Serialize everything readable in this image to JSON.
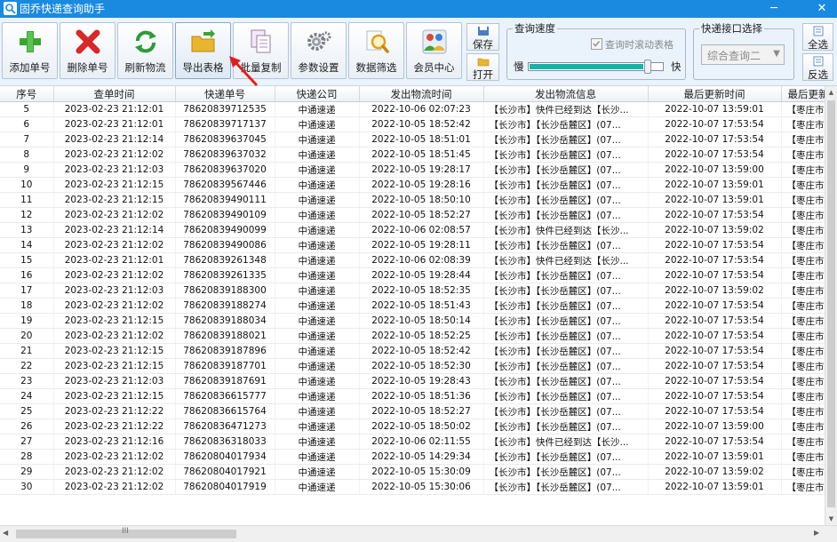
{
  "window": {
    "title": "固乔快递查询助手",
    "minimize": "─",
    "close": "✕"
  },
  "toolbar": {
    "buttons": [
      {
        "label": "添加单号",
        "icon": "add-plus-icon"
      },
      {
        "label": "删除单号",
        "icon": "delete-x-icon"
      },
      {
        "label": "刷新物流",
        "icon": "refresh-icon"
      },
      {
        "label": "导出表格",
        "icon": "export-folder-icon"
      },
      {
        "label": "批量复制",
        "icon": "copy-documents-icon"
      },
      {
        "label": "参数设置",
        "icon": "settings-gear-icon"
      },
      {
        "label": "数据筛选",
        "icon": "filter-magnifier-icon"
      },
      {
        "label": "会员中心",
        "icon": "member-users-icon"
      }
    ],
    "save_label": "保存",
    "open_label": "打开",
    "speed_group": {
      "title": "查询速度",
      "scroll_checkbox_label": "查询时滚动表格",
      "scroll_checked": true,
      "slow": "慢",
      "fast": "快",
      "level": 0.85
    },
    "api_group": {
      "title": "快递接口选择",
      "selected": "综合查询二"
    },
    "select_all": "全选",
    "invert_select": "反选"
  },
  "grid": {
    "columns": [
      "序号",
      "查单时间",
      "快递单号",
      "快递公司",
      "发出物流时间",
      "发出物流信息",
      "最后更新时间",
      "最后更新"
    ],
    "rows": [
      [
        "5",
        "2023-02-23 21:12:01",
        "78620839712535",
        "中通速递",
        "2022-10-06 02:07:23",
        "【长沙市】快件已经到达【长沙...",
        "2022-10-07 13:59:01",
        "【枣庄市"
      ],
      [
        "6",
        "2023-02-23 21:12:01",
        "78620839717137",
        "中通速递",
        "2022-10-05 18:52:42",
        "【长沙市】【长沙岳麓区】(07...",
        "2022-10-07 17:53:54",
        "【枣庄市"
      ],
      [
        "7",
        "2023-02-23 21:12:14",
        "78620839637045",
        "中通速递",
        "2022-10-05 18:51:01",
        "【长沙市】【长沙岳麓区】(07...",
        "2022-10-07 17:53:54",
        "【枣庄市"
      ],
      [
        "8",
        "2023-02-23 21:12:02",
        "78620839637032",
        "中通速递",
        "2022-10-05 18:51:45",
        "【长沙市】【长沙岳麓区】(07...",
        "2022-10-07 17:53:54",
        "【枣庄市"
      ],
      [
        "9",
        "2023-02-23 21:12:03",
        "78620839637020",
        "中通速递",
        "2022-10-05 19:28:17",
        "【长沙市】【长沙岳麓区】(07...",
        "2022-10-07 13:59:00",
        "【枣庄市"
      ],
      [
        "10",
        "2023-02-23 21:12:15",
        "78620839567446",
        "中通速递",
        "2022-10-05 19:28:16",
        "【长沙市】【长沙岳麓区】(07...",
        "2022-10-07 13:59:01",
        "【枣庄市"
      ],
      [
        "11",
        "2023-02-23 21:12:15",
        "78620839490111",
        "中通速递",
        "2022-10-05 18:50:10",
        "【长沙市】【长沙岳麓区】(07...",
        "2022-10-07 13:59:01",
        "【枣庄市"
      ],
      [
        "12",
        "2023-02-23 21:12:02",
        "78620839490109",
        "中通速递",
        "2022-10-05 18:52:27",
        "【长沙市】【长沙岳麓区】(07...",
        "2022-10-07 17:53:54",
        "【枣庄市"
      ],
      [
        "13",
        "2023-02-23 21:12:14",
        "78620839490099",
        "中通速递",
        "2022-10-06 02:08:57",
        "【长沙市】快件已经到达【长沙...",
        "2022-10-07 13:59:02",
        "【枣庄市"
      ],
      [
        "14",
        "2023-02-23 21:12:02",
        "78620839490086",
        "中通速递",
        "2022-10-05 19:28:11",
        "【长沙市】【长沙岳麓区】(07...",
        "2022-10-07 17:53:54",
        "【枣庄市"
      ],
      [
        "15",
        "2023-02-23 21:12:01",
        "78620839261348",
        "中通速递",
        "2022-10-06 02:08:39",
        "【长沙市】快件已经到达【长沙...",
        "2022-10-07 17:53:54",
        "【枣庄市"
      ],
      [
        "16",
        "2023-02-23 21:12:02",
        "78620839261335",
        "中通速递",
        "2022-10-05 19:28:44",
        "【长沙市】【长沙岳麓区】(07...",
        "2022-10-07 17:53:54",
        "【枣庄市"
      ],
      [
        "17",
        "2023-02-23 21:12:03",
        "78620839188300",
        "中通速递",
        "2022-10-05 18:52:35",
        "【长沙市】【长沙岳麓区】(07...",
        "2022-10-07 13:59:02",
        "【枣庄市"
      ],
      [
        "18",
        "2023-02-23 21:12:02",
        "78620839188274",
        "中通速递",
        "2022-10-05 18:51:43",
        "【长沙市】【长沙岳麓区】(07...",
        "2022-10-07 17:53:54",
        "【枣庄市"
      ],
      [
        "19",
        "2023-02-23 21:12:15",
        "78620839188034",
        "中通速递",
        "2022-10-05 18:50:14",
        "【长沙市】【长沙岳麓区】(07...",
        "2022-10-07 17:53:54",
        "【枣庄市"
      ],
      [
        "20",
        "2023-02-23 21:12:02",
        "78620839188021",
        "中通速递",
        "2022-10-05 18:52:25",
        "【长沙市】【长沙岳麓区】(07...",
        "2022-10-07 17:53:54",
        "【枣庄市"
      ],
      [
        "21",
        "2023-02-23 21:12:15",
        "78620839187896",
        "中通速递",
        "2022-10-05 18:52:42",
        "【长沙市】【长沙岳麓区】(07...",
        "2022-10-07 17:53:54",
        "【枣庄市"
      ],
      [
        "22",
        "2023-02-23 21:12:15",
        "78620839187701",
        "中通速递",
        "2022-10-05 18:52:30",
        "【长沙市】【长沙岳麓区】(07...",
        "2022-10-07 17:53:54",
        "【枣庄市"
      ],
      [
        "23",
        "2023-02-23 21:12:03",
        "78620839187691",
        "中通速递",
        "2022-10-05 19:28:43",
        "【长沙市】【长沙岳麓区】(07...",
        "2022-10-07 17:53:54",
        "【枣庄市"
      ],
      [
        "24",
        "2023-02-23 21:12:15",
        "78620836615777",
        "中通速递",
        "2022-10-05 18:51:36",
        "【长沙市】【长沙岳麓区】(07...",
        "2022-10-07 17:53:54",
        "【枣庄市"
      ],
      [
        "25",
        "2023-02-23 21:12:22",
        "78620836615764",
        "中通速递",
        "2022-10-05 18:52:27",
        "【长沙市】【长沙岳麓区】(07...",
        "2022-10-07 17:53:54",
        "【枣庄市"
      ],
      [
        "26",
        "2023-02-23 21:12:22",
        "78620836471273",
        "中通速递",
        "2022-10-05 18:50:02",
        "【长沙市】【长沙岳麓区】(07...",
        "2022-10-07 13:59:00",
        "【枣庄市"
      ],
      [
        "27",
        "2023-02-23 21:12:16",
        "78620836318033",
        "中通速递",
        "2022-10-06 02:11:55",
        "【长沙市】快件已经到达【长沙...",
        "2022-10-07 17:53:54",
        "【枣庄市"
      ],
      [
        "28",
        "2023-02-23 21:12:02",
        "78620804017934",
        "中通速递",
        "2022-10-05 14:29:34",
        "【长沙市】【长沙岳麓区】(07...",
        "2022-10-07 13:59:01",
        "【枣庄市"
      ],
      [
        "29",
        "2023-02-23 21:12:02",
        "78620804017921",
        "中通速递",
        "2022-10-05 15:30:09",
        "【长沙市】【长沙岳麓区】(07...",
        "2022-10-07 13:59:02",
        "【枣庄市"
      ],
      [
        "30",
        "2023-02-23 21:12:02",
        "78620804017919",
        "中通速递",
        "2022-10-05 15:30:06",
        "【长沙市】【长沙岳麓区】(07...",
        "2022-10-07 13:59:01",
        "【枣庄市"
      ]
    ]
  },
  "scrollbar": {
    "grip": "III"
  }
}
